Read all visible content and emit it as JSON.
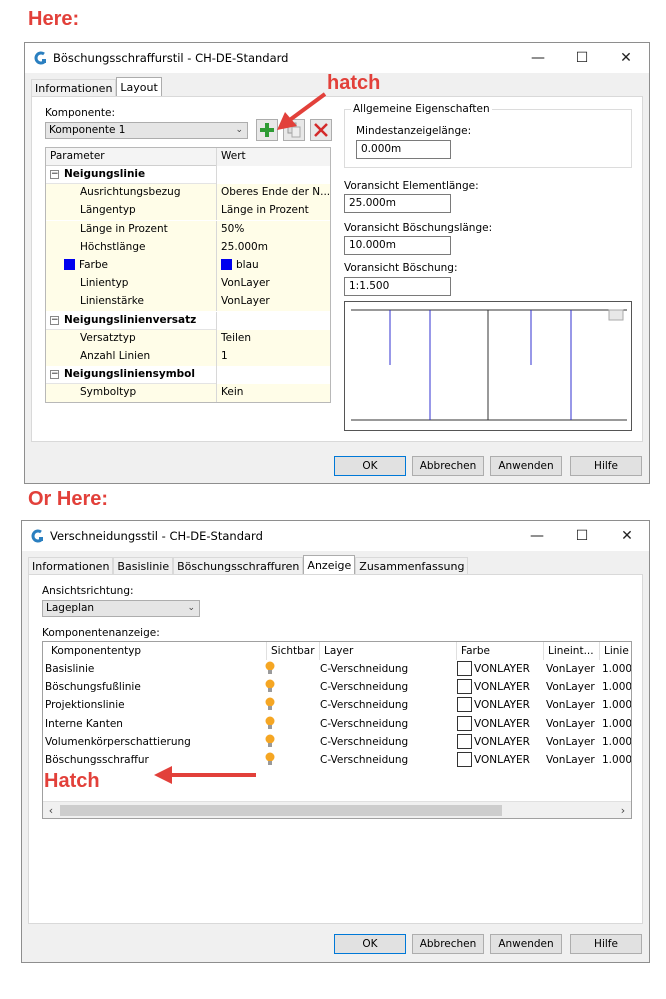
{
  "captions": {
    "top": "Here:",
    "bottom": "Or Here:"
  },
  "accent_red": "#e2403a",
  "dialog1": {
    "title": "Böschungsschraffurstil - CH-DE-Standard",
    "tabs": [
      "Informationen",
      "Layout"
    ],
    "active_tab": "Layout",
    "component_label": "Komponente:",
    "component_value": "Komponente 1",
    "tool_icons": [
      "add-icon",
      "copy-icon",
      "delete-icon"
    ],
    "annotation": "hatch",
    "grid_headers": {
      "param": "Parameter",
      "value": "Wert"
    },
    "rows": [
      {
        "type": "cat",
        "label": "Neigungslinie",
        "value": ""
      },
      {
        "type": "sub",
        "label": "Ausrichtungsbezug",
        "value": "Oberes Ende der N..."
      },
      {
        "type": "sub",
        "label": "Längentyp",
        "value": "Länge in Prozent"
      },
      {
        "type": "sub",
        "label": "Länge in Prozent",
        "value": "50%"
      },
      {
        "type": "sub",
        "label": "Höchstlänge",
        "value": "25.000m"
      },
      {
        "type": "color",
        "label": "Farbe",
        "value": "blau",
        "color": "#0000ee"
      },
      {
        "type": "sub",
        "label": "Linientyp",
        "value": "VonLayer"
      },
      {
        "type": "sub",
        "label": "Linienstärke",
        "value": "VonLayer"
      },
      {
        "type": "cat",
        "label": "Neigungslinienversatz",
        "value": ""
      },
      {
        "type": "sub",
        "label": "Versatztyp",
        "value": "Teilen"
      },
      {
        "type": "sub",
        "label": "Anzahl Linien",
        "value": "1"
      },
      {
        "type": "cat",
        "label": "Neigungsliniensymbol",
        "value": ""
      },
      {
        "type": "sub",
        "label": "Symboltyp",
        "value": "Kein"
      }
    ],
    "general_group": "Allgemeine Eigenschaften",
    "min_display_label": "Mindestanzeigelänge:",
    "min_display_value": "0.000m",
    "elem_len_label": "Voransicht Elementlänge:",
    "elem_len_value": "25.000m",
    "slope_len_label": "Voransicht Böschungslänge:",
    "slope_len_value": "10.000m",
    "slope_label": "Voransicht Böschung:",
    "slope_value": "1:1.500",
    "buttons": {
      "ok": "OK",
      "cancel": "Abbrechen",
      "apply": "Anwenden",
      "help": "Hilfe"
    }
  },
  "dialog2": {
    "title": "Verschneidungsstil - CH-DE-Standard",
    "tabs": [
      "Informationen",
      "Basislinie",
      "Böschungsschraffuren",
      "Anzeige",
      "Zusammenfassung"
    ],
    "active_tab": "Anzeige",
    "view_dir_label": "Ansichtsrichtung:",
    "view_dir_value": "Lageplan",
    "comp_display_label": "Komponentenanzeige:",
    "columns": [
      "Komponententyp",
      "Sichtbar",
      "Layer",
      "Farbe",
      "Lineint...",
      "Linie"
    ],
    "rows": [
      {
        "type": "Basislinie",
        "layer": "C-Verschneidung",
        "color": "VONLAYER",
        "linetype": "VonLayer",
        "weight": "1.000"
      },
      {
        "type": "Böschungsfußlinie",
        "layer": "C-Verschneidung",
        "color": "VONLAYER",
        "linetype": "VonLayer",
        "weight": "1.000"
      },
      {
        "type": "Projektionslinie",
        "layer": "C-Verschneidung",
        "color": "VONLAYER",
        "linetype": "VonLayer",
        "weight": "1.000"
      },
      {
        "type": "Interne Kanten",
        "layer": "C-Verschneidung",
        "color": "VONLAYER",
        "linetype": "VonLayer",
        "weight": "1.000"
      },
      {
        "type": "Volumenkörperschattierung",
        "layer": "C-Verschneidung",
        "color": "VONLAYER",
        "linetype": "VonLayer",
        "weight": "1.000"
      },
      {
        "type": "Böschungsschraffur",
        "layer": "C-Verschneidung",
        "color": "VONLAYER",
        "linetype": "VonLayer",
        "weight": "1.000"
      }
    ],
    "annotation": "Hatch",
    "buttons": {
      "ok": "OK",
      "cancel": "Abbrechen",
      "apply": "Anwenden",
      "help": "Hilfe"
    }
  }
}
